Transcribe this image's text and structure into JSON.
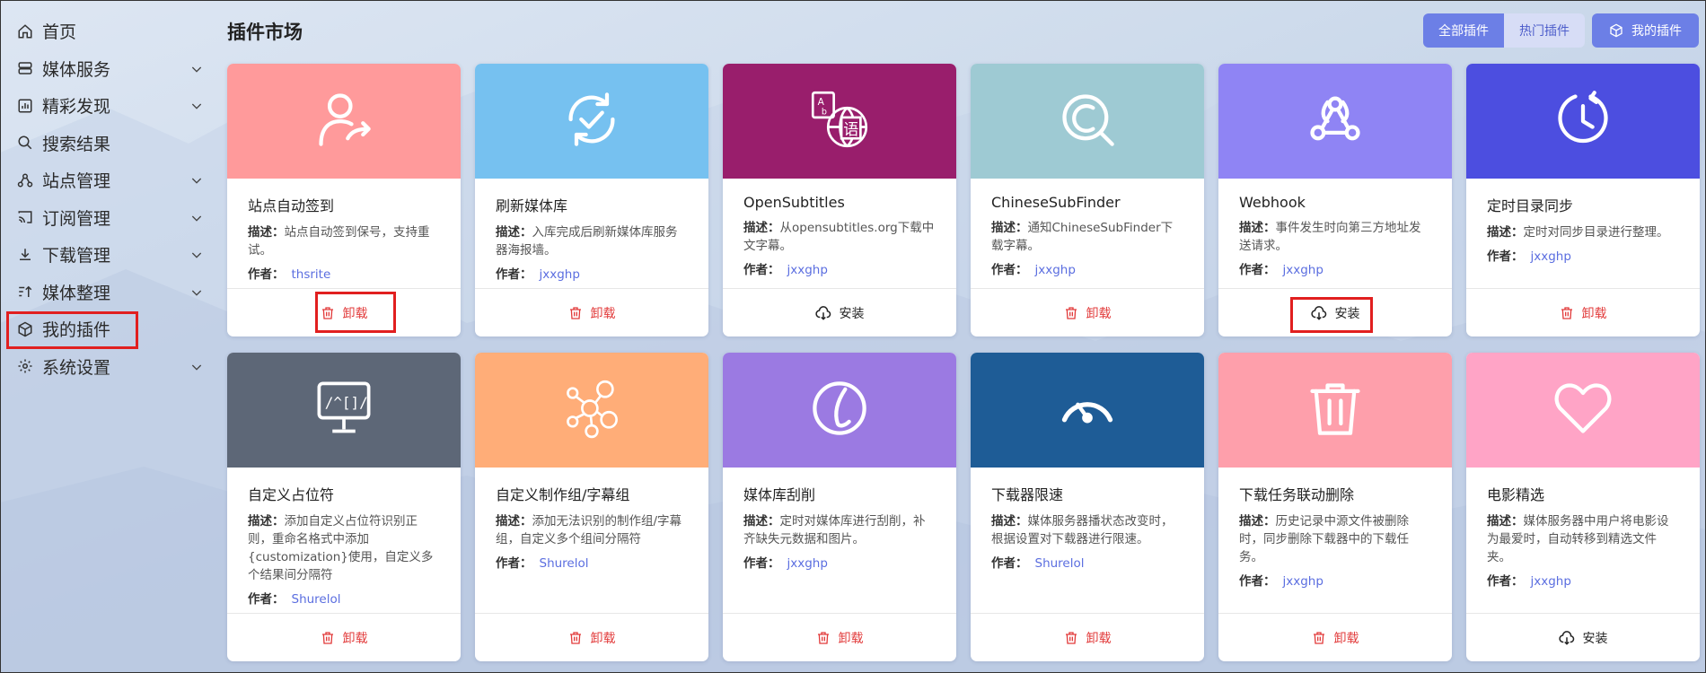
{
  "sidebar": {
    "items": [
      {
        "label": "首页",
        "icon": "home-icon",
        "expandable": false
      },
      {
        "label": "媒体服务",
        "icon": "server-icon",
        "expandable": true
      },
      {
        "label": "精彩发现",
        "icon": "chart-icon",
        "expandable": true
      },
      {
        "label": "搜索结果",
        "icon": "search-icon",
        "expandable": false
      },
      {
        "label": "站点管理",
        "icon": "sitemap-icon",
        "expandable": true
      },
      {
        "label": "订阅管理",
        "icon": "cast-icon",
        "expandable": true
      },
      {
        "label": "下载管理",
        "icon": "download-icon",
        "expandable": true
      },
      {
        "label": "媒体整理",
        "icon": "sort-icon",
        "expandable": true
      },
      {
        "label": "我的插件",
        "icon": "cube-icon",
        "expandable": false,
        "highlighted": true
      },
      {
        "label": "系统设置",
        "icon": "gear-icon",
        "expandable": true
      }
    ]
  },
  "header": {
    "title": "插件市场",
    "filters": [
      "全部插件",
      "热门插件"
    ],
    "my_plugins": "我的插件"
  },
  "labels": {
    "desc": "描述：",
    "author": "作者："
  },
  "actions": {
    "uninstall": "卸载",
    "install": "安装"
  },
  "colors": {
    "accent": "#6c7fe6",
    "uninstall": "#e23b3b",
    "author_link": "#5b6ee0",
    "highlight_box": "#e11f1f"
  },
  "plugins": [
    {
      "name": "站点自动签到",
      "desc": "站点自动签到保号，支持重试。",
      "author": "thsrite",
      "action": "uninstall",
      "color": "#ff9a9b",
      "icon": "user-share-icon",
      "highlighted": true
    },
    {
      "name": "刷新媒体库",
      "desc": "入库完成后刷新媒体库服务器海报墙。",
      "author": "jxxghp",
      "action": "uninstall",
      "color": "#76c1f0",
      "icon": "refresh-check-icon"
    },
    {
      "name": "OpenSubtitles",
      "desc": "从opensubtitles.org下载中文字幕。",
      "author": "jxxghp",
      "action": "install",
      "color": "#991e6c",
      "icon": "language-icon"
    },
    {
      "name": "ChineseSubFinder",
      "desc": "通知ChineseSubFinder下载字幕。",
      "author": "jxxghp",
      "action": "uninstall",
      "color": "#9ecad3",
      "icon": "subfinder-icon"
    },
    {
      "name": "Webhook",
      "desc": "事件发生时向第三方地址发送请求。",
      "author": "jxxghp",
      "action": "install",
      "color": "#8f84f4",
      "icon": "webhook-icon",
      "highlighted": true
    },
    {
      "name": "定时目录同步",
      "desc": "定时对同步目录进行整理。",
      "author": "jxxghp",
      "action": "uninstall",
      "color": "#4c4ee0",
      "icon": "clock-sync-icon"
    },
    {
      "name": "自定义占位符",
      "desc": "添加自定义占位符识别正则，重命名格式中添加{customization}使用，自定义多个结果间分隔符",
      "author": "Shurelol",
      "action": "uninstall",
      "color": "#5d6777",
      "icon": "regex-monitor-icon"
    },
    {
      "name": "自定义制作组/字幕组",
      "desc": "添加无法识别的制作组/字幕组，自定义多个组间分隔符",
      "author": "Shurelol",
      "action": "uninstall",
      "color": "#ffad78",
      "icon": "group-network-icon"
    },
    {
      "name": "媒体库刮削",
      "desc": "定时对媒体库进行刮削，补齐缺失元数据和图片。",
      "author": "jxxghp",
      "action": "uninstall",
      "color": "#9b7ae2",
      "icon": "scrape-logo-icon"
    },
    {
      "name": "下载器限速",
      "desc": "媒体服务器播状态改变时，根据设置对下载器进行限速。",
      "author": "Shurelol",
      "action": "uninstall",
      "color": "#1e5c96",
      "icon": "speedometer-icon"
    },
    {
      "name": "下载任务联动删除",
      "desc": "历史记录中源文件被删除时，同步删除下载器中的下载任务。",
      "author": "jxxghp",
      "action": "uninstall",
      "color": "#fe9fab",
      "icon": "trash-icon"
    },
    {
      "name": "电影精选",
      "desc": "媒体服务器中用户将电影设为最爱时，自动转移到精选文件夹。",
      "author": "jxxghp",
      "action": "install",
      "color": "#ffa4c6",
      "icon": "heart-icon"
    }
  ]
}
